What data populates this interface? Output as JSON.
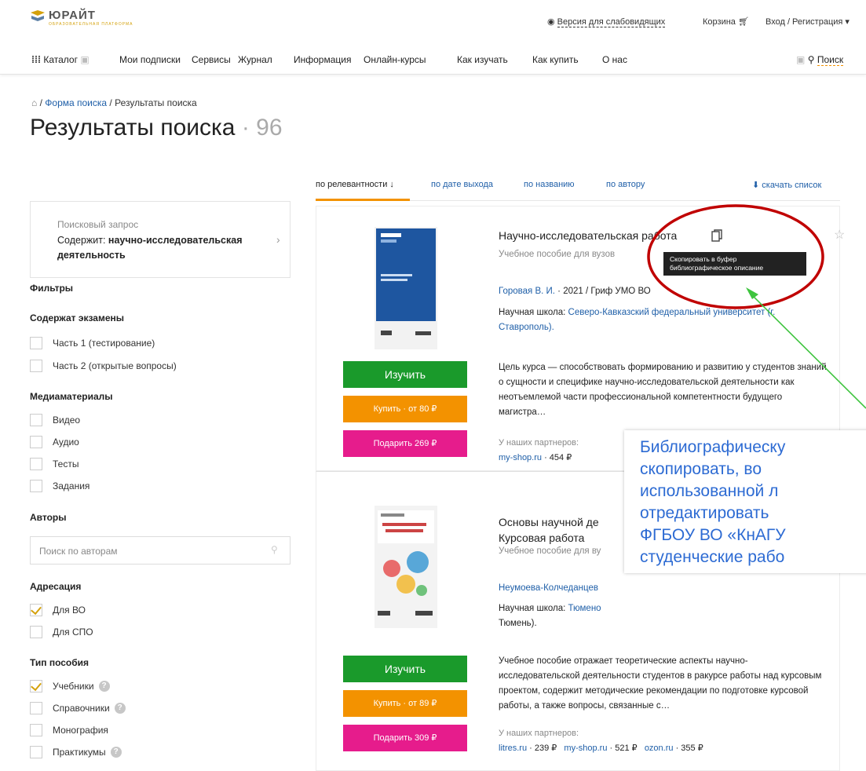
{
  "header": {
    "logo": {
      "name": "ЮРАЙТ",
      "sub": "ОБРАЗОВАТЕЛЬНАЯ ПЛАТФОРМА"
    },
    "accessibility": "Версия для слабовидящих",
    "cart": "Корзина",
    "login": "Вход / Регистрация"
  },
  "nav": {
    "catalog": "Каталог",
    "items": [
      "Мои подписки",
      "Сервисы",
      "Журнал",
      "Информация",
      "Онлайн-курсы",
      "Как изучать",
      "Как купить",
      "О нас"
    ],
    "search": "Поиск"
  },
  "breadcrumb": {
    "items": [
      "Форма поиска",
      "Результаты поиска"
    ],
    "sep": "/"
  },
  "page": {
    "title": "Результаты поиска",
    "count": "96"
  },
  "sort": {
    "options": [
      "по релевантности ↓",
      "по дате выхода",
      "по названию",
      "по автору"
    ],
    "download": "скачать список"
  },
  "query": {
    "label": "Поисковый запрос",
    "prefix": "Содержит: ",
    "value": "научно-исследовательская деятельность"
  },
  "filters": {
    "title": "Фильтры",
    "exams": {
      "title": "Содержат экзамены",
      "items": [
        "Часть 1 (тестирование)",
        "Часть 2 (открытые вопросы)"
      ]
    },
    "media": {
      "title": "Медиаматериалы",
      "items": [
        "Видео",
        "Аудио",
        "Тесты",
        "Задания"
      ]
    },
    "authors": {
      "title": "Авторы",
      "placeholder": "Поиск по авторам"
    },
    "audience": {
      "title": "Адресация",
      "items": [
        "Для ВО",
        "Для СПО"
      ]
    },
    "type": {
      "title": "Тип пособия",
      "items": [
        "Учебники",
        "Справочники",
        "Монография",
        "Практикумы"
      ]
    }
  },
  "results": [
    {
      "title": "Научно-исследовательская работа",
      "subtitle": "Учебное пособие для вузов",
      "author": "Горовая В. И.",
      "meta": " · 2021 / Гриф УМО ВО",
      "school_label": "Научная школа: ",
      "school": "Северо-Кавказский федеральный университет (г. Ставрополь).",
      "description": "Цель курса — способствовать формированию и развитию у студентов знаний о сущности и специфике научно-исследовательской деятельности как неотъемлемой части профессиональной компетентности будущего магистра…",
      "partners_label": "У наших партнеров:",
      "partners": [
        {
          "site": "my-shop.ru",
          "price": " · 454 ₽"
        }
      ],
      "btn_study": "Изучить",
      "btn_buy": "Купить · от 80 ₽",
      "btn_gift": "Подарить 269 ₽"
    },
    {
      "title": "Основы научной де",
      "title2": "Курсовая работа",
      "subtitle": "Учебное пособие для ву",
      "author": "Неумоева-Колчеданцев",
      "school_label": "Научная школа: ",
      "school": "Тюмено",
      "school2": "Тюмень).",
      "description": "Учебное пособие отражает теоретические аспекты научно-исследовательской деятельности студентов в ракурсе работы над курсовым проектом, содержит методические рекомендации по подготовке курсовой работы, а также вопросы, связанные с…",
      "partners_label": "У наших партнеров:",
      "partners": [
        {
          "site": "litres.ru",
          "price": " · 239 ₽"
        },
        {
          "site": "my-shop.ru",
          "price": " · 521 ₽"
        },
        {
          "site": "ozon.ru",
          "price": " · 355 ₽"
        }
      ],
      "btn_study": "Изучить",
      "btn_buy": "Купить · от 89 ₽",
      "btn_gift": "Подарить 309 ₽"
    }
  ],
  "tooltip": {
    "line1": "Скопировать в буфер",
    "line2": "библиографическое описание"
  },
  "annotation": {
    "lines": [
      "Библиографическу",
      "скопировать,       во",
      "использованной  л",
      "отредактировать",
      "ФГБОУ ВО «КнАГУ",
      "студенческие рабо"
    ]
  },
  "colors": {
    "accent": "#f39200",
    "link": "#1f5fa8",
    "study": "#1a9a2b",
    "gift": "#e61c8c",
    "annotation": "#2d6bd3",
    "highlight": "#c00000",
    "arrow": "#3ec43e"
  }
}
